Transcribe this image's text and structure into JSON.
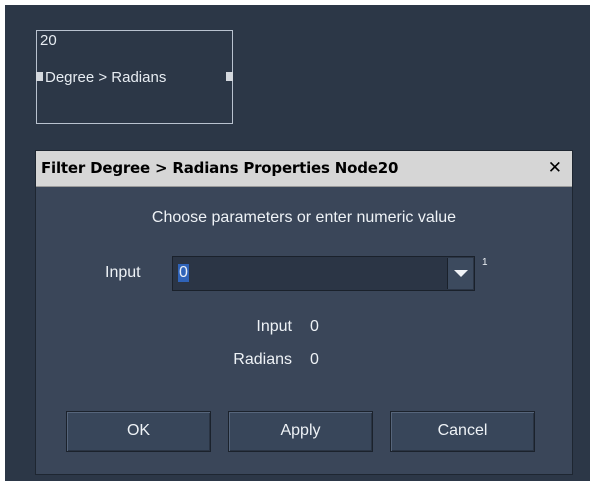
{
  "node": {
    "id": "20",
    "label": "Degree > Radians"
  },
  "dialog": {
    "title": "Filter Degree > Radians Properties Node20",
    "close_glyph": "✕",
    "instruction": "Choose parameters or enter numeric value",
    "input": {
      "label": "Input",
      "value": "0",
      "superscript": "1"
    },
    "stats": [
      {
        "label": "Input",
        "value": "0"
      },
      {
        "label": "Radians",
        "value": "0"
      }
    ],
    "buttons": {
      "ok": "OK",
      "apply": "Apply",
      "cancel": "Cancel"
    }
  },
  "icons": {
    "close": "close-icon",
    "dropdown": "chevron-down-icon"
  },
  "colors": {
    "canvas_bg": "#2c3747",
    "dialog_bg": "#3a4659",
    "titlebar_bg": "#d6d6d6",
    "selection": "#2f63b8"
  }
}
